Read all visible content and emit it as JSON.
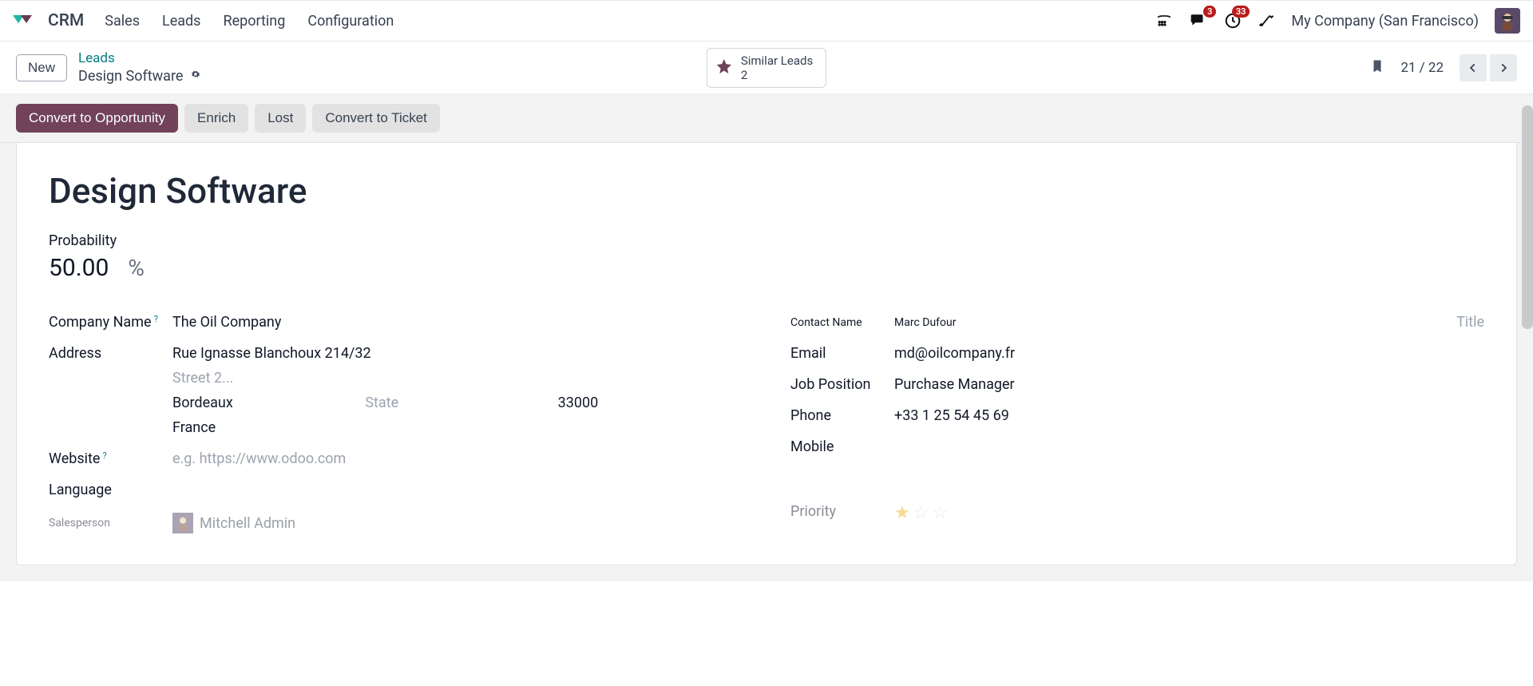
{
  "app": {
    "title": "CRM"
  },
  "nav": {
    "items": [
      "Sales",
      "Leads",
      "Reporting",
      "Configuration"
    ]
  },
  "topbar": {
    "messages_badge": "3",
    "activities_badge": "33",
    "company": "My Company (San Francisco)"
  },
  "subbar": {
    "new_label": "New",
    "breadcrumb_parent": "Leads",
    "breadcrumb_current": "Design Software",
    "similar_title": "Similar Leads",
    "similar_count": "2",
    "pager": "21 / 22"
  },
  "actions": {
    "convert": "Convert to Opportunity",
    "enrich": "Enrich",
    "lost": "Lost",
    "ticket": "Convert to Ticket"
  },
  "record": {
    "name": "Design Software",
    "probability_label": "Probability",
    "probability_value": "50.00",
    "probability_unit": "%"
  },
  "left": {
    "company_label": "Company Name",
    "company_value": "The Oil Company",
    "address_label": "Address",
    "street": "Rue Ignasse Blanchoux 214/32",
    "street2_placeholder": "Street 2...",
    "city": "Bordeaux",
    "state_placeholder": "State",
    "zip": "33000",
    "country": "France",
    "website_label": "Website",
    "website_placeholder": "e.g. https://www.odoo.com",
    "language_label": "Language",
    "salesperson_label": "Salesperson",
    "salesperson_value": "Mitchell Admin"
  },
  "right": {
    "contact_label": "Contact Name",
    "contact_value": "Marc Dufour",
    "title_placeholder": "Title",
    "email_label": "Email",
    "email_value": "md@oilcompany.fr",
    "job_label": "Job Position",
    "job_value": "Purchase Manager",
    "phone_label": "Phone",
    "phone_value": "+33 1 25 54 45 69",
    "mobile_label": "Mobile",
    "priority_label": "Priority"
  }
}
